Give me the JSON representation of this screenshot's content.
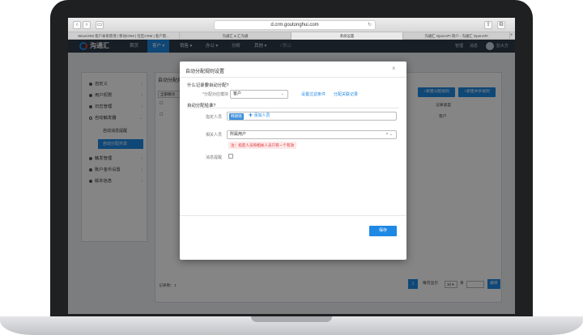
{
  "browser": {
    "address": "d.crm.goutonghui.com",
    "tabs": [
      "WiseCRM 客户关系管理 | 移动CRM | 社区CRM | 客户管...",
      "沟通汇 & 汇沟通",
      "系统设置",
      "沟通汇 OpenAPI 简介 - 沟通汇 OpenAPI"
    ]
  },
  "nav": {
    "logo_text": "沟通汇",
    "items": [
      "首页",
      "客户 ▾",
      "销售 ▾",
      "办公 ▾",
      "分析",
      "其他 ▾",
      "/ 默认"
    ],
    "right": [
      "管理",
      "消息",
      "彭大方"
    ]
  },
  "sidebar": {
    "items": [
      {
        "label": "自定义",
        "chev": "›"
      },
      {
        "label": "用户权限",
        "chev": "›"
      },
      {
        "label": "日志管理",
        "chev": "›"
      },
      {
        "label": "自动触发器",
        "chev": "⌄"
      }
    ],
    "subitems": [
      "自动消息提醒",
      "自动分配共享"
    ],
    "items_after": [
      {
        "label": "触发管理",
        "chev": "›"
      },
      {
        "label": "账户金币设置",
        "chev": "›"
      },
      {
        "label": "版本信息",
        "chev": "›"
      }
    ]
  },
  "content": {
    "title": "自动分配共",
    "filter": "全部模块",
    "btn_new_assign": "+新建分配规则",
    "btn_new_share": "+新建共享规则",
    "col_type": "记录类型",
    "row_type": "客户",
    "col_type2": "分配",
    "footer_label": "记录数：",
    "footer_count": "1"
  },
  "pager": {
    "page": "1",
    "per_page_label": "每页显示",
    "per_page_value": "10 ▾",
    "suffix": "条",
    "go": "跳转"
  },
  "modal": {
    "title": "自动分配规则设置",
    "close": "×",
    "section1": "什么记录要自动分配?",
    "module_label": "*分配对应模块",
    "module_value": "客户",
    "link_filter": "设置过滤条件",
    "link_related": "分配关联记录",
    "section2": "自动分配给谁?",
    "assignee_label": "指定人员",
    "assignee_tag": "韩晓晓",
    "add_person": "✚ 添加人员",
    "related_label": "相关人员",
    "related_value": "所属用户",
    "warning": "注：指定人员和相关人员只有一个有效",
    "notify_label": "消息提醒",
    "save": "保存"
  }
}
